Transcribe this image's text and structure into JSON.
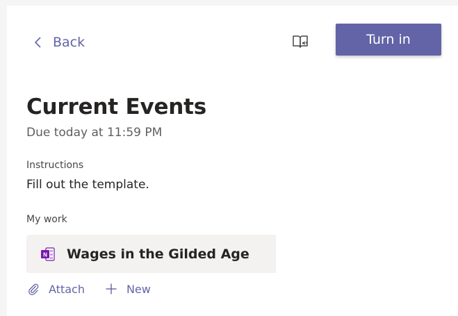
{
  "nav": {
    "back_label": "Back"
  },
  "toolbar": {
    "turn_in_label": "Turn in",
    "reader_icon": "immersive-reader-icon"
  },
  "assignment": {
    "title": "Current Events",
    "due": "Due today at 11:59 PM",
    "instructions_label": "Instructions",
    "instructions_text": "Fill out the template."
  },
  "my_work": {
    "label": "My work",
    "files": [
      {
        "name": "Wages in the Gilded Age",
        "icon": "onenote-icon"
      }
    ],
    "actions": {
      "attach_label": "Attach",
      "new_label": "New"
    }
  },
  "colors": {
    "accent": "#6264a7",
    "text": "#252423",
    "muted": "#605e5c",
    "card": "#f3f2f1",
    "onenote": "#7719aa"
  }
}
